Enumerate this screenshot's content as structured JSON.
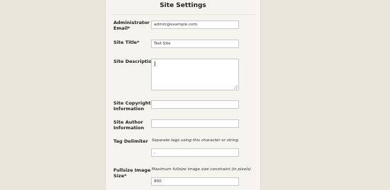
{
  "page": {
    "title": "Site Settings"
  },
  "fields": {
    "admin_email": {
      "label": "Administrator Email*",
      "value": "admin@example.com"
    },
    "site_title": {
      "label": "Site Title*",
      "value": "Test Site"
    },
    "site_description": {
      "label": "Site Description",
      "value": ""
    },
    "copyright": {
      "label": "Site Copyright Information",
      "value": ""
    },
    "author": {
      "label": "Site Author Information",
      "value": ""
    },
    "tag_delimiter": {
      "label": "Tag Delimiter",
      "hint": "Separate tags using this character or string.",
      "value": ","
    },
    "fullsize": {
      "label": "Fullsize Image Size*",
      "hint": "Maximum fullsize image size constraint (in pixels)",
      "value": "800"
    }
  }
}
